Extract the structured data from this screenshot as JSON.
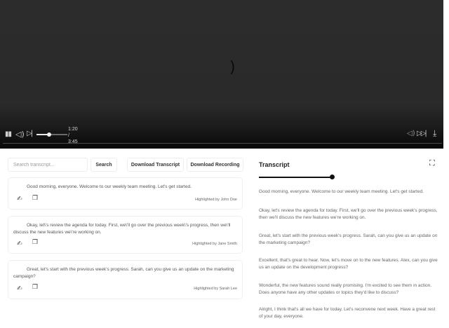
{
  "player": {
    "time_current": "1:20",
    "time_separator": "/",
    "time_total": "3:45",
    "volume_level": 0.42,
    "icons": {
      "play_pause": "pause-icon",
      "volume": "volume-icon",
      "skip": "skip-next-icon",
      "right_speaker": "speaker-icon",
      "right_skip": "skip-next-icon",
      "download": "download-icon",
      "loading": "loading-spinner-icon"
    }
  },
  "toolbar": {
    "search_placeholder": "Search transcript...",
    "search_label": "Search",
    "download_transcript_label": "Download Transcript",
    "download_recording_label": "Download Recording"
  },
  "highlights": [
    {
      "text": "Good morning, everyone. Welcome to our weekly team meeting. Let's get started.",
      "credit": "Highlighted by John Doe"
    },
    {
      "text": "Okay, let\\'s review the agenda for today. First, we\\'ll go over the previous week\\'s progress, then we\\'ll discuss the new features we\\'re working on.",
      "credit": "Highlighted by Jane Smith"
    },
    {
      "text": "Great, let's start with the previous week's progress. Sarah, can you give us an update on the marketing campaign?",
      "credit": "Highlighted by Sarah Lee"
    }
  ],
  "transcript": {
    "title": "Transcript",
    "position": 1.0,
    "lines": [
      "Good morning, everyone. Welcome to our weekly team meeting. Let's get started.",
      "Okay, let's review the agenda for today. First, we'll go over the previous week's progress, then we'll discuss the new features we're working on.",
      "Great, let's start with the previous week's progress. Sarah, can you give us an update on the marketing campaign?",
      "Excellent, that's great to hear. Now, let's move on to the new features. Alex, can you give us an update on the development progress?",
      "Wonderful, the new features sound really promising. I'm excited to see them in action. Does anyone have any other updates or topics they'd like to discuss?",
      "Alright, I think that's all we have for today. Let's reconvene next week. Have a great rest of your day, everyone."
    ]
  }
}
